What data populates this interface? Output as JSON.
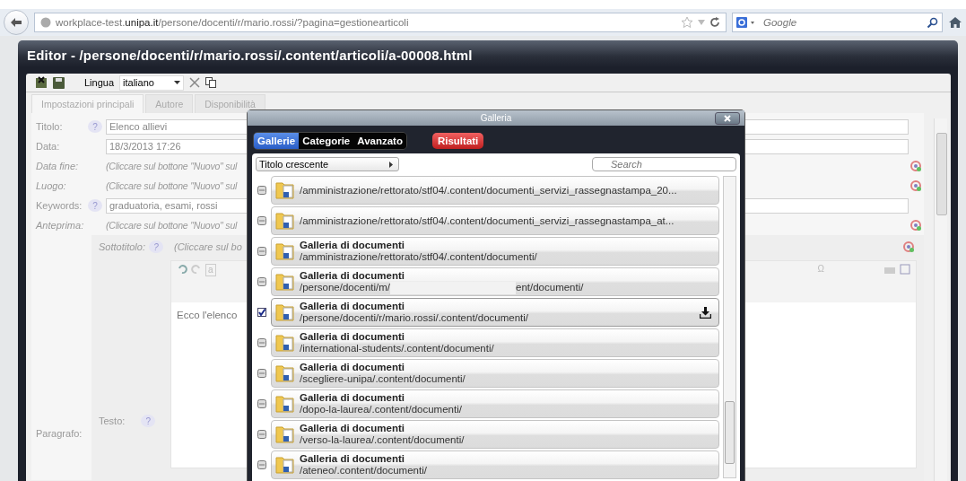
{
  "browser": {
    "url": "workplace-test.**unipa.it**/persone/docenti/r/mario.rossi/?pagina=gestionearticoli",
    "search": {
      "placeholder": "Google"
    }
  },
  "editor": {
    "title": "Editor - /persone/docenti/r/mario.rossi/.content/articoli/a-00008.html",
    "toolbar": {
      "language_label": "Lingua",
      "language": "italiano"
    },
    "tabs": [
      {
        "label": "Impostazioni principali",
        "selected": true
      },
      {
        "label": "Autore",
        "selected": false
      },
      {
        "label": "Disponibilità",
        "selected": false
      }
    ],
    "fields": [
      {
        "kind": "input",
        "label": "Titolo:",
        "help": "?",
        "value": "Elenco allievi"
      },
      {
        "kind": "input",
        "label": "Data:",
        "value": "18/3/2013 17:26"
      },
      {
        "kind": "empty",
        "label": "Data fine:",
        "value": "(Cliccare sul bottone \"Nuovo\" sul"
      },
      {
        "kind": "empty",
        "label": "Luogo:",
        "value": "(Cliccare sul bottone \"Nuovo\" sul"
      },
      {
        "kind": "input",
        "label": "Keywords:",
        "help": "?",
        "value": "graduatoria, esami, rossi"
      },
      {
        "kind": "empty",
        "label": "Anteprima:",
        "value": "(Cliccare sul bottone \"Nuovo\" sul"
      }
    ],
    "paragraph": {
      "label": "Paragrafo:",
      "subtitle_label": "Sottotitolo:",
      "subtitle_help": "?",
      "subtitle_value": "(Cliccare sul bo",
      "rte_symbols": [
        "a",
        "Ω"
      ],
      "body": "Ecco l'elenco",
      "text_label": "Testo:",
      "text_help": "?"
    }
  },
  "gallery": {
    "title": "Galleria",
    "tabs": [
      {
        "label": "Gallerie",
        "selected": true
      },
      {
        "label": "Categorie",
        "selected": false
      },
      {
        "label": "Avanzato",
        "selected": false
      }
    ],
    "results_button": "Risultati",
    "sort": "Titolo crescente",
    "search": {
      "placeholder": "Search"
    },
    "items": [
      {
        "path": "/amministrazione/rettorato/stf04/.content/documenti_servizi_rassegnastampa_20...",
        "selected": false
      },
      {
        "path": "/amministrazione/rettorato/stf04/.content/documenti_servizi_rassegnastampa_at...",
        "selected": false
      },
      {
        "title": "Galleria di documenti",
        "path": "/amministrazione/rettorato/stf04/.content/documenti/",
        "selected": false
      },
      {
        "title": "Galleria di documenti",
        "path": "/persone/docenti/m/",
        "path_end": "ent/documenti/",
        "redacted": true,
        "selected": false
      },
      {
        "title": "Galleria di documenti",
        "path": "/persone/docenti/r/mario.rossi/.content/documenti/",
        "selected": true
      },
      {
        "title": "Galleria di documenti",
        "path": "/international-students/.content/documenti/",
        "selected": false
      },
      {
        "title": "Galleria di documenti",
        "path": "/scegliere-unipa/.content/documenti/",
        "selected": false
      },
      {
        "title": "Galleria di documenti",
        "path": "/dopo-la-laurea/.content/documenti/",
        "selected": false
      },
      {
        "title": "Galleria di documenti",
        "path": "/verso-la-laurea/.content/documenti/",
        "selected": false
      },
      {
        "title": "Galleria di documenti",
        "path": "/ateneo/.content/documenti/",
        "selected": false
      }
    ]
  }
}
